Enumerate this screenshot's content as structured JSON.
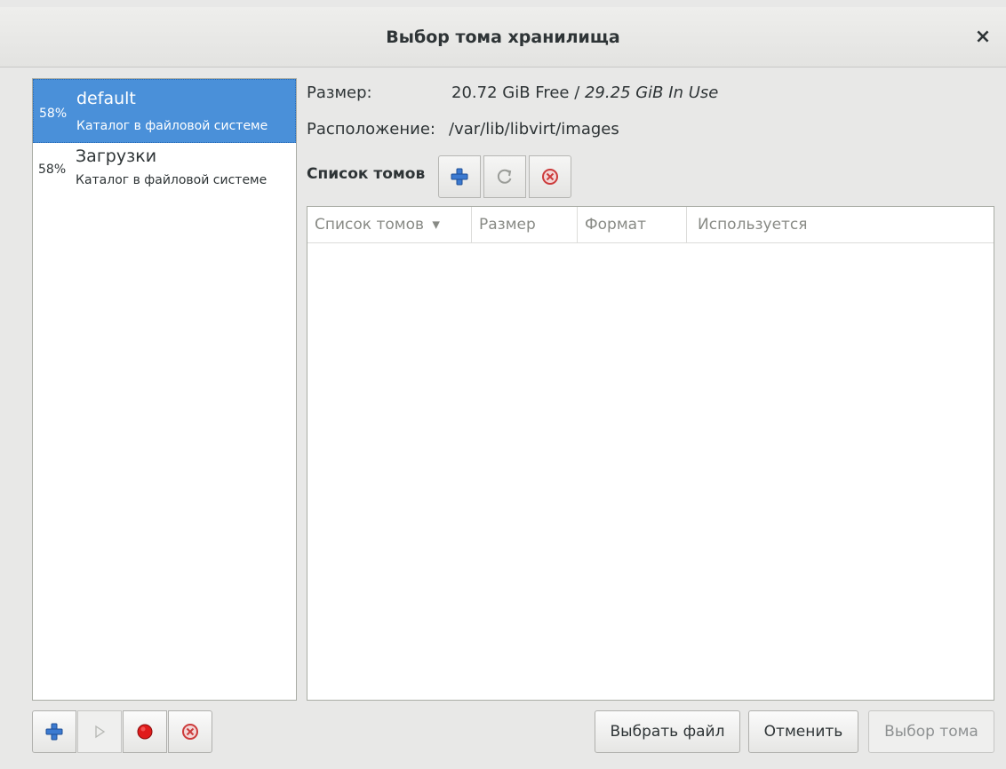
{
  "window": {
    "title": "Выбор тома хранилища",
    "close_label": "×"
  },
  "pools": [
    {
      "usage": "58%",
      "name": "default",
      "description": "Каталог в файловой системе",
      "selected": true
    },
    {
      "usage": "58%",
      "name": "Загрузки",
      "description": "Каталог в файловой системе",
      "selected": false
    }
  ],
  "info": {
    "size_label": "Размер:",
    "size_free": "20.72 GiB Free",
    "size_sep": " / ",
    "size_in_use": "29.25 GiB In Use",
    "location_label": "Расположение:",
    "location_value": "/var/lib/libvirt/images"
  },
  "volumes": {
    "heading": "Список томов",
    "columns": [
      "Список томов",
      "Размер",
      "Формат",
      "Используется"
    ],
    "sort_indicator": "▾"
  },
  "buttons": {
    "browse": "Выбрать файл",
    "cancel": "Отменить",
    "choose": "Выбор тома"
  },
  "icons": {
    "add": "plus-icon",
    "refresh": "refresh-icon",
    "delete": "delete-icon",
    "start": "play-icon",
    "stop": "record-icon"
  },
  "colors": {
    "selection": "#4a90d9",
    "add": "#3b7ad1",
    "delete": "#cc3b3b",
    "stop": "#e01b1b"
  }
}
